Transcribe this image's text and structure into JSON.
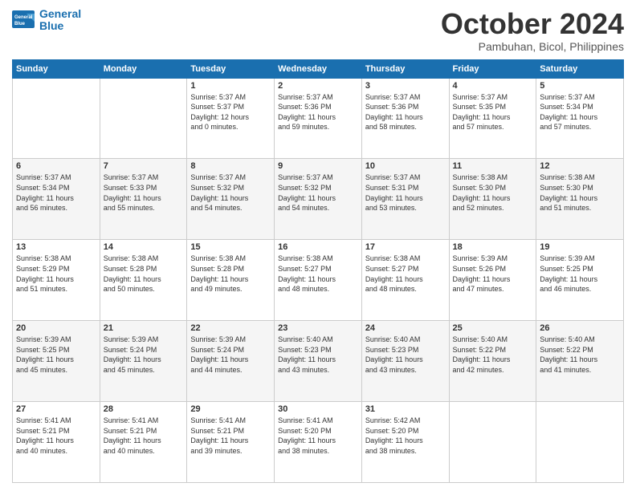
{
  "logo": {
    "line1": "General",
    "line2": "Blue"
  },
  "title": "October 2024",
  "subtitle": "Pambuhan, Bicol, Philippines",
  "weekdays": [
    "Sunday",
    "Monday",
    "Tuesday",
    "Wednesday",
    "Thursday",
    "Friday",
    "Saturday"
  ],
  "weeks": [
    [
      {
        "day": "",
        "content": ""
      },
      {
        "day": "",
        "content": ""
      },
      {
        "day": "1",
        "content": "Sunrise: 5:37 AM\nSunset: 5:37 PM\nDaylight: 12 hours\nand 0 minutes."
      },
      {
        "day": "2",
        "content": "Sunrise: 5:37 AM\nSunset: 5:36 PM\nDaylight: 11 hours\nand 59 minutes."
      },
      {
        "day": "3",
        "content": "Sunrise: 5:37 AM\nSunset: 5:36 PM\nDaylight: 11 hours\nand 58 minutes."
      },
      {
        "day": "4",
        "content": "Sunrise: 5:37 AM\nSunset: 5:35 PM\nDaylight: 11 hours\nand 57 minutes."
      },
      {
        "day": "5",
        "content": "Sunrise: 5:37 AM\nSunset: 5:34 PM\nDaylight: 11 hours\nand 57 minutes."
      }
    ],
    [
      {
        "day": "6",
        "content": "Sunrise: 5:37 AM\nSunset: 5:34 PM\nDaylight: 11 hours\nand 56 minutes."
      },
      {
        "day": "7",
        "content": "Sunrise: 5:37 AM\nSunset: 5:33 PM\nDaylight: 11 hours\nand 55 minutes."
      },
      {
        "day": "8",
        "content": "Sunrise: 5:37 AM\nSunset: 5:32 PM\nDaylight: 11 hours\nand 54 minutes."
      },
      {
        "day": "9",
        "content": "Sunrise: 5:37 AM\nSunset: 5:32 PM\nDaylight: 11 hours\nand 54 minutes."
      },
      {
        "day": "10",
        "content": "Sunrise: 5:37 AM\nSunset: 5:31 PM\nDaylight: 11 hours\nand 53 minutes."
      },
      {
        "day": "11",
        "content": "Sunrise: 5:38 AM\nSunset: 5:30 PM\nDaylight: 11 hours\nand 52 minutes."
      },
      {
        "day": "12",
        "content": "Sunrise: 5:38 AM\nSunset: 5:30 PM\nDaylight: 11 hours\nand 51 minutes."
      }
    ],
    [
      {
        "day": "13",
        "content": "Sunrise: 5:38 AM\nSunset: 5:29 PM\nDaylight: 11 hours\nand 51 minutes."
      },
      {
        "day": "14",
        "content": "Sunrise: 5:38 AM\nSunset: 5:28 PM\nDaylight: 11 hours\nand 50 minutes."
      },
      {
        "day": "15",
        "content": "Sunrise: 5:38 AM\nSunset: 5:28 PM\nDaylight: 11 hours\nand 49 minutes."
      },
      {
        "day": "16",
        "content": "Sunrise: 5:38 AM\nSunset: 5:27 PM\nDaylight: 11 hours\nand 48 minutes."
      },
      {
        "day": "17",
        "content": "Sunrise: 5:38 AM\nSunset: 5:27 PM\nDaylight: 11 hours\nand 48 minutes."
      },
      {
        "day": "18",
        "content": "Sunrise: 5:39 AM\nSunset: 5:26 PM\nDaylight: 11 hours\nand 47 minutes."
      },
      {
        "day": "19",
        "content": "Sunrise: 5:39 AM\nSunset: 5:25 PM\nDaylight: 11 hours\nand 46 minutes."
      }
    ],
    [
      {
        "day": "20",
        "content": "Sunrise: 5:39 AM\nSunset: 5:25 PM\nDaylight: 11 hours\nand 45 minutes."
      },
      {
        "day": "21",
        "content": "Sunrise: 5:39 AM\nSunset: 5:24 PM\nDaylight: 11 hours\nand 45 minutes."
      },
      {
        "day": "22",
        "content": "Sunrise: 5:39 AM\nSunset: 5:24 PM\nDaylight: 11 hours\nand 44 minutes."
      },
      {
        "day": "23",
        "content": "Sunrise: 5:40 AM\nSunset: 5:23 PM\nDaylight: 11 hours\nand 43 minutes."
      },
      {
        "day": "24",
        "content": "Sunrise: 5:40 AM\nSunset: 5:23 PM\nDaylight: 11 hours\nand 43 minutes."
      },
      {
        "day": "25",
        "content": "Sunrise: 5:40 AM\nSunset: 5:22 PM\nDaylight: 11 hours\nand 42 minutes."
      },
      {
        "day": "26",
        "content": "Sunrise: 5:40 AM\nSunset: 5:22 PM\nDaylight: 11 hours\nand 41 minutes."
      }
    ],
    [
      {
        "day": "27",
        "content": "Sunrise: 5:41 AM\nSunset: 5:21 PM\nDaylight: 11 hours\nand 40 minutes."
      },
      {
        "day": "28",
        "content": "Sunrise: 5:41 AM\nSunset: 5:21 PM\nDaylight: 11 hours\nand 40 minutes."
      },
      {
        "day": "29",
        "content": "Sunrise: 5:41 AM\nSunset: 5:21 PM\nDaylight: 11 hours\nand 39 minutes."
      },
      {
        "day": "30",
        "content": "Sunrise: 5:41 AM\nSunset: 5:20 PM\nDaylight: 11 hours\nand 38 minutes."
      },
      {
        "day": "31",
        "content": "Sunrise: 5:42 AM\nSunset: 5:20 PM\nDaylight: 11 hours\nand 38 minutes."
      },
      {
        "day": "",
        "content": ""
      },
      {
        "day": "",
        "content": ""
      }
    ]
  ]
}
